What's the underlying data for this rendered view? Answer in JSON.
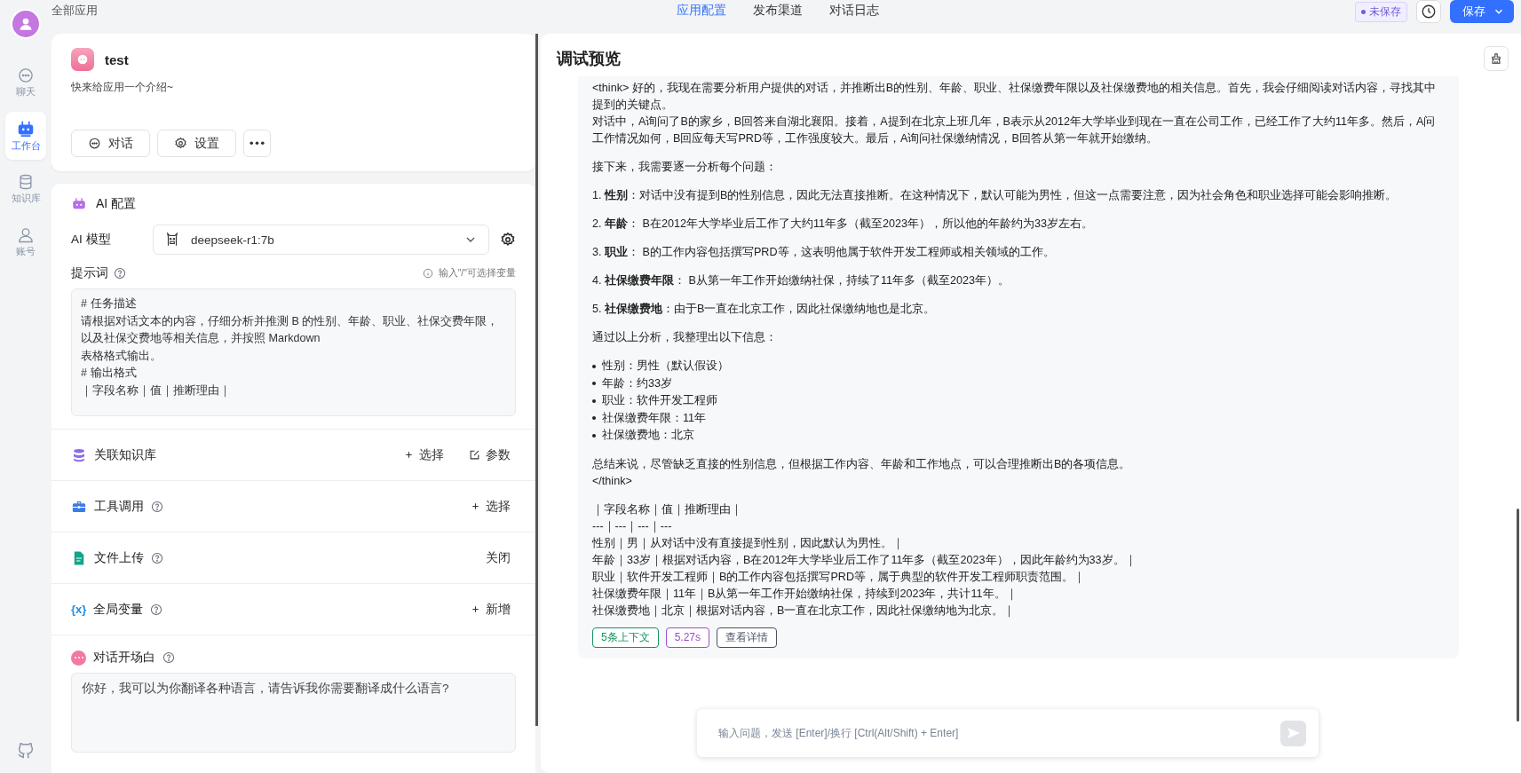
{
  "nav": {
    "items": [
      {
        "label": "聊天",
        "selected": false
      },
      {
        "label": "工作台",
        "selected": true
      },
      {
        "label": "知识库",
        "selected": false
      },
      {
        "label": "账号",
        "selected": false
      }
    ]
  },
  "header": {
    "breadcrumb": "全部应用",
    "tabs": [
      {
        "label": "应用配置",
        "selected": true
      },
      {
        "label": "发布渠道",
        "selected": false
      },
      {
        "label": "对话日志",
        "selected": false
      }
    ],
    "status": "未保存",
    "save": "保存"
  },
  "app": {
    "name": "test",
    "intro": "快来给应用一个介绍~",
    "buttons": [
      "对话",
      "设置"
    ]
  },
  "ai_config": {
    "title": "AI 配置",
    "model_label": "AI 模型",
    "model": "deepseek-r1:7b",
    "prompt_label": "提示词",
    "prompt_hint": "输入\"/\"可选择变量",
    "prompt_lines": [
      "# 任务描述",
      "请根据对话文本的内容，仔细分析并推测 B 的性别、年龄、职业、社保交费年限，以及社保交费地等相关信息，并按照 Markdown",
      "表格格式输出。",
      "# 输出格式",
      "｜字段名称｜值｜推断理由｜"
    ],
    "sections": [
      {
        "title": "关联知识库",
        "help": false,
        "actions": [
          {
            "kind": "add",
            "label": "选择"
          },
          {
            "kind": "edit",
            "label": "参数"
          }
        ]
      },
      {
        "title": "工具调用",
        "help": true,
        "actions": [
          {
            "kind": "add",
            "label": "选择"
          }
        ]
      },
      {
        "title": "文件上传",
        "help": true,
        "actions": [
          {
            "kind": "text",
            "label": "关闭"
          }
        ]
      },
      {
        "symbol": "{x}",
        "title": "全局变量",
        "help": true,
        "actions": [
          {
            "kind": "add",
            "label": "新增"
          }
        ]
      }
    ],
    "opening": {
      "title": "对话开场白",
      "text": "你好，我可以为你翻译各种语言，请告诉我你需要翻译成什么语言?"
    }
  },
  "preview": {
    "title": "调试预览",
    "blocks": [
      {
        "kind": "para",
        "lines": [
          "<think> 好的，我现在需要分析用户提供的对话，并推断出B的性别、年龄、职业、社保缴费年限以及社保缴费地的相关信息。首先，我会仔细阅读对话内容，寻找其中提到的关键点。",
          "对话中，A询问了B的家乡，B回答来自湖北襄阳。接着，A提到在北京上班几年，B表示从2012年大学毕业到现在一直在公司工作，已经工作了大约11年多。然后，A问工作情况如何，B回应每天写PRD等，工作强度较大。最后，A询问社保缴纳情况，B回答从第一年就开始缴纳。"
        ]
      },
      {
        "kind": "para",
        "lines": [
          "接下来，我需要逐一分析每个问题："
        ]
      },
      {
        "kind": "para",
        "lines": [
          "1. **性别**：对话中没有提到B的性别信息，因此无法直接推断。在这种情况下，默认可能为男性，但这一点需要注意，因为社会角色和职业选择可能会影响推断。"
        ]
      },
      {
        "kind": "para",
        "lines": [
          "2. **年龄**： B在2012年大学毕业后工作了大约11年多（截至2023年），所以他的年龄约为33岁左右。"
        ]
      },
      {
        "kind": "para",
        "lines": [
          "3. **职业**： B的工作内容包括撰写PRD等，这表明他属于软件开发工程师或相关领域的工作。"
        ]
      },
      {
        "kind": "para",
        "lines": [
          "4. **社保缴费年限**： B从第一年工作开始缴纳社保，持续了11年多（截至2023年）。"
        ]
      },
      {
        "kind": "para",
        "lines": [
          "5. **社保缴费地**：由于B一直在北京工作，因此社保缴纳地也是北京。"
        ]
      },
      {
        "kind": "para",
        "lines": [
          "通过以上分析，我整理出以下信息："
        ]
      },
      {
        "kind": "list",
        "lines": [
          "性别：男性（默认假设）",
          "年龄：约33岁",
          "职业：软件开发工程师",
          "社保缴费年限：11年",
          "社保缴费地：北京"
        ]
      },
      {
        "kind": "para",
        "lines": [
          "总结来说，尽管缺乏直接的性别信息，但根据工作内容、年龄和工作地点，可以合理推断出B的各项信息。",
          "</think>"
        ]
      },
      {
        "kind": "para",
        "lines": [
          "｜字段名称｜值｜推断理由｜",
          "---｜---｜---｜---",
          "性别｜男｜从对话中没有直接提到性别，因此默认为男性。｜",
          "年龄｜33岁｜根据对话内容，B在2012年大学毕业后工作了11年多（截至2023年），因此年龄约为33岁。｜",
          "职业｜软件开发工程师｜B的工作内容包括撰写PRD等，属于典型的软件开发工程师职责范围。｜",
          "社保缴费年限｜11年｜B从第一年工作开始缴纳社保，持续到2023年，共计11年。｜",
          "社保缴费地｜北京｜根据对话内容，B一直在北京工作，因此社保缴纳地为北京。｜"
        ]
      }
    ],
    "tags": [
      {
        "label": "5条上下文",
        "color": "#14935f"
      },
      {
        "label": "5.27s",
        "color": "#9c4fc7"
      },
      {
        "label": "查看详情",
        "color": "#485264"
      }
    ],
    "input_placeholder": "输入问题，发送 [Enter]/换行 [Ctrl(Alt/Shift) + Enter]"
  }
}
